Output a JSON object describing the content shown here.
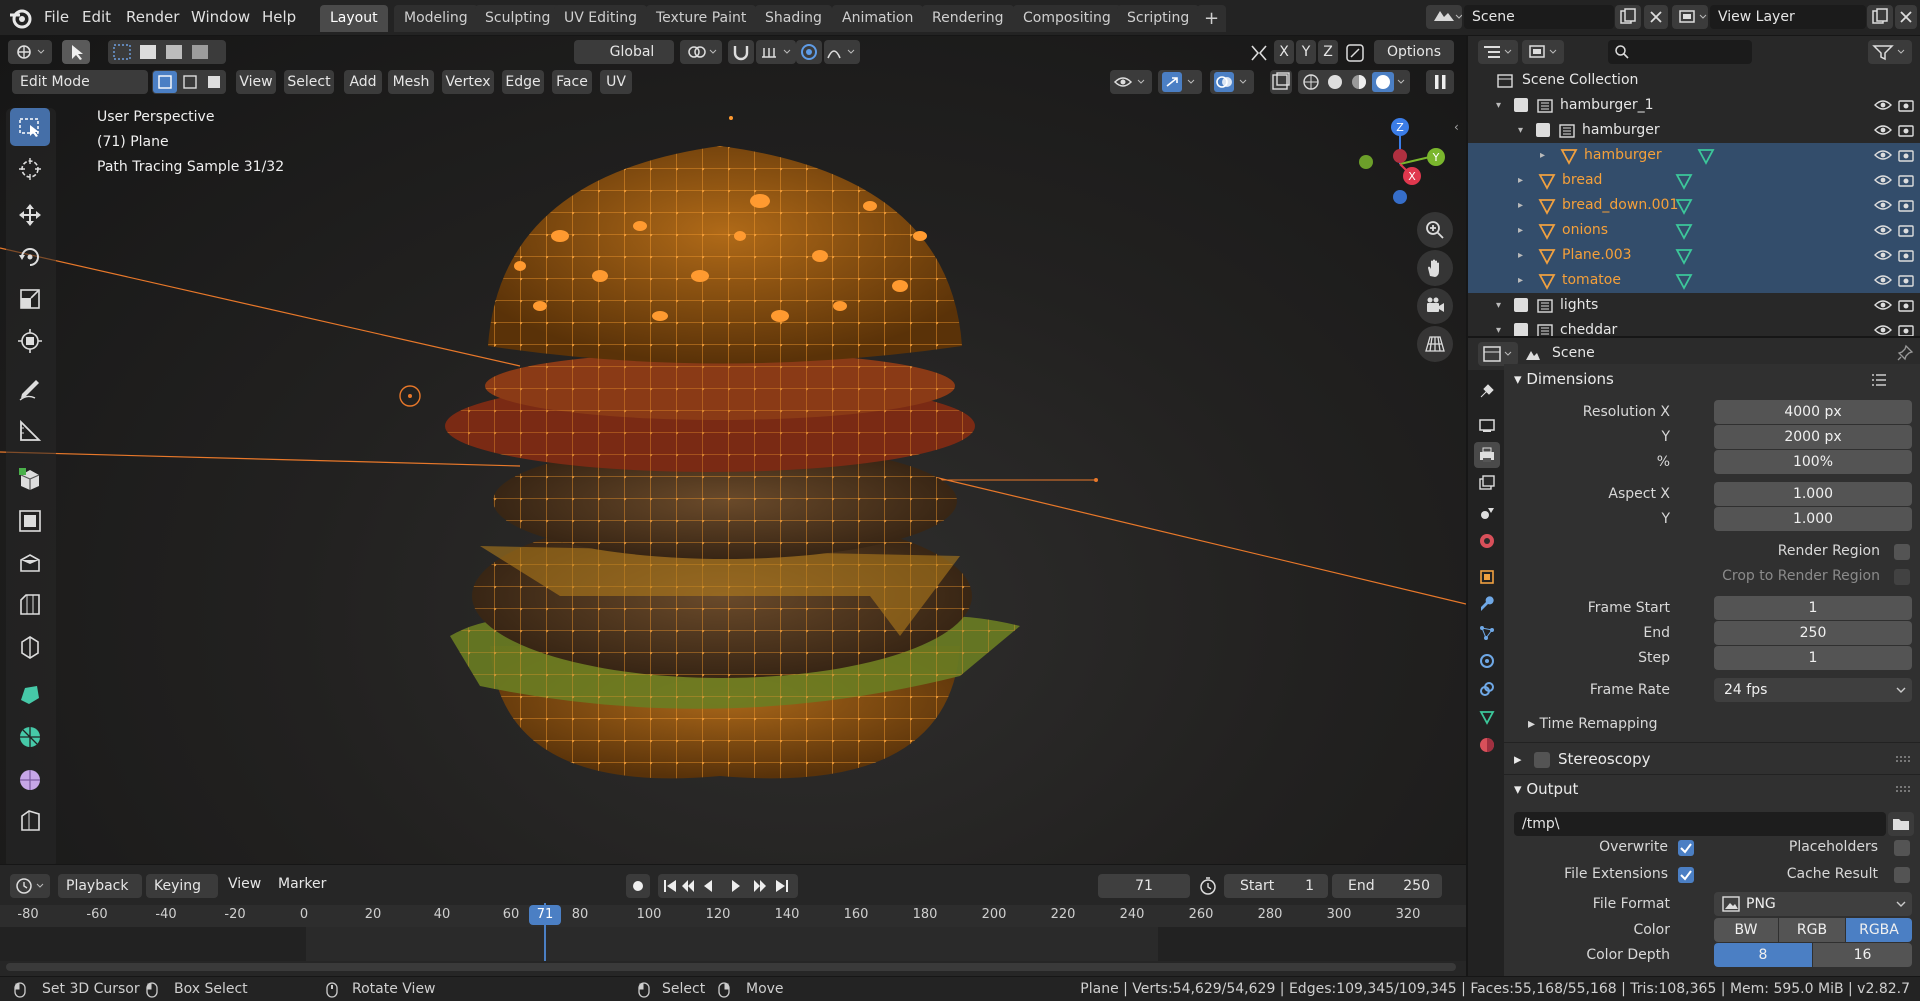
{
  "topbar": {
    "menus": [
      "File",
      "Edit",
      "Render",
      "Window",
      "Help"
    ],
    "workspaces": [
      "Layout",
      "Modeling",
      "Sculpting",
      "UV Editing",
      "Texture Paint",
      "Shading",
      "Animation",
      "Rendering",
      "Compositing",
      "Scripting"
    ],
    "active_workspace": "Layout",
    "add_tab": "+",
    "scene": "Scene",
    "view_layer": "View Layer"
  },
  "toolheader": {
    "orientation": "Global",
    "axes": [
      "X",
      "Y",
      "Z"
    ],
    "options": "Options"
  },
  "viewport_header": {
    "mode": "Edit Mode",
    "menus": [
      "View",
      "Select",
      "Add",
      "Mesh",
      "Vertex",
      "Edge",
      "Face",
      "UV"
    ]
  },
  "overlay": {
    "perspective": "User Perspective",
    "object": "(71) Plane",
    "render_status": "Path Tracing Sample 31/32"
  },
  "gizmo": {
    "x": "X",
    "y": "Y",
    "z": "Z"
  },
  "timeline": {
    "menus": [
      "Playback",
      "Keying",
      "View",
      "Marker"
    ],
    "current_frame": "71",
    "start_label": "Start",
    "start": "1",
    "end_label": "End",
    "end": "250",
    "ruler": [
      "-80",
      "-60",
      "-40",
      "-20",
      "0",
      "20",
      "40",
      "60",
      "71",
      "80",
      "100",
      "120",
      "140",
      "160",
      "180",
      "200",
      "220",
      "240",
      "260",
      "280",
      "300",
      "320"
    ]
  },
  "statusbar": {
    "hint1": "Set 3D Cursor",
    "hint2": "Box Select",
    "hint3": "Rotate View",
    "hint4": "Select",
    "hint5": "Move",
    "stats": "Plane | Verts:54,629/54,629 | Edges:109,345/109,345 | Faces:55,168/55,168 | Tris:108,365 | Mem: 595.0 MiB | v2.82.7"
  },
  "outliner": {
    "root": "Scene Collection",
    "rows": [
      {
        "label": "hamburger_1",
        "type": "collection",
        "depth": 0,
        "selected": false
      },
      {
        "label": "hamburger",
        "type": "collection",
        "depth": 1,
        "selected": false
      },
      {
        "label": "hamburger",
        "type": "mesh",
        "depth": 2,
        "selected": true
      },
      {
        "label": "bread",
        "type": "mesh",
        "depth": 1,
        "selected": true
      },
      {
        "label": "bread_down.001",
        "type": "mesh",
        "depth": 1,
        "selected": true
      },
      {
        "label": "onions",
        "type": "mesh",
        "depth": 1,
        "selected": true
      },
      {
        "label": "Plane.003",
        "type": "mesh",
        "depth": 1,
        "selected": true
      },
      {
        "label": "tomatoe",
        "type": "mesh",
        "depth": 1,
        "selected": true
      },
      {
        "label": "lights",
        "type": "collection",
        "depth": 0,
        "selected": false
      },
      {
        "label": "cheddar",
        "type": "collection",
        "depth": 0,
        "selected": false
      }
    ]
  },
  "properties": {
    "context": "Scene",
    "dimensions": {
      "title": "Dimensions",
      "res_x_label": "Resolution X",
      "res_x": "4000 px",
      "res_y_label": "Y",
      "res_y": "2000 px",
      "pct_label": "%",
      "pct": "100%",
      "aspect_x_label": "Aspect X",
      "aspect_x": "1.000",
      "aspect_y_label": "Y",
      "aspect_y": "1.000",
      "render_region": "Render Region",
      "crop": "Crop to Render Region",
      "frame_start_label": "Frame Start",
      "frame_start": "1",
      "end_label": "End",
      "end": "250",
      "step_label": "Step",
      "step": "1",
      "frame_rate_label": "Frame Rate",
      "frame_rate": "24 fps",
      "time_remap": "Time Remapping"
    },
    "stereoscopy": "Stereoscopy",
    "output": {
      "title": "Output",
      "path": "/tmp\\",
      "overwrite": "Overwrite",
      "placeholders": "Placeholders",
      "file_ext": "File Extensions",
      "cache": "Cache Result",
      "format_label": "File Format",
      "format": "PNG",
      "color_label": "Color",
      "colors": [
        "BW",
        "RGB",
        "RGBA"
      ],
      "depth_label": "Color Depth",
      "depths": [
        "8",
        "16"
      ]
    }
  },
  "colors": {
    "accent": "#4b7fc4",
    "selected_orange": "#f5a03a",
    "outliner_sel": "#334d6b"
  }
}
